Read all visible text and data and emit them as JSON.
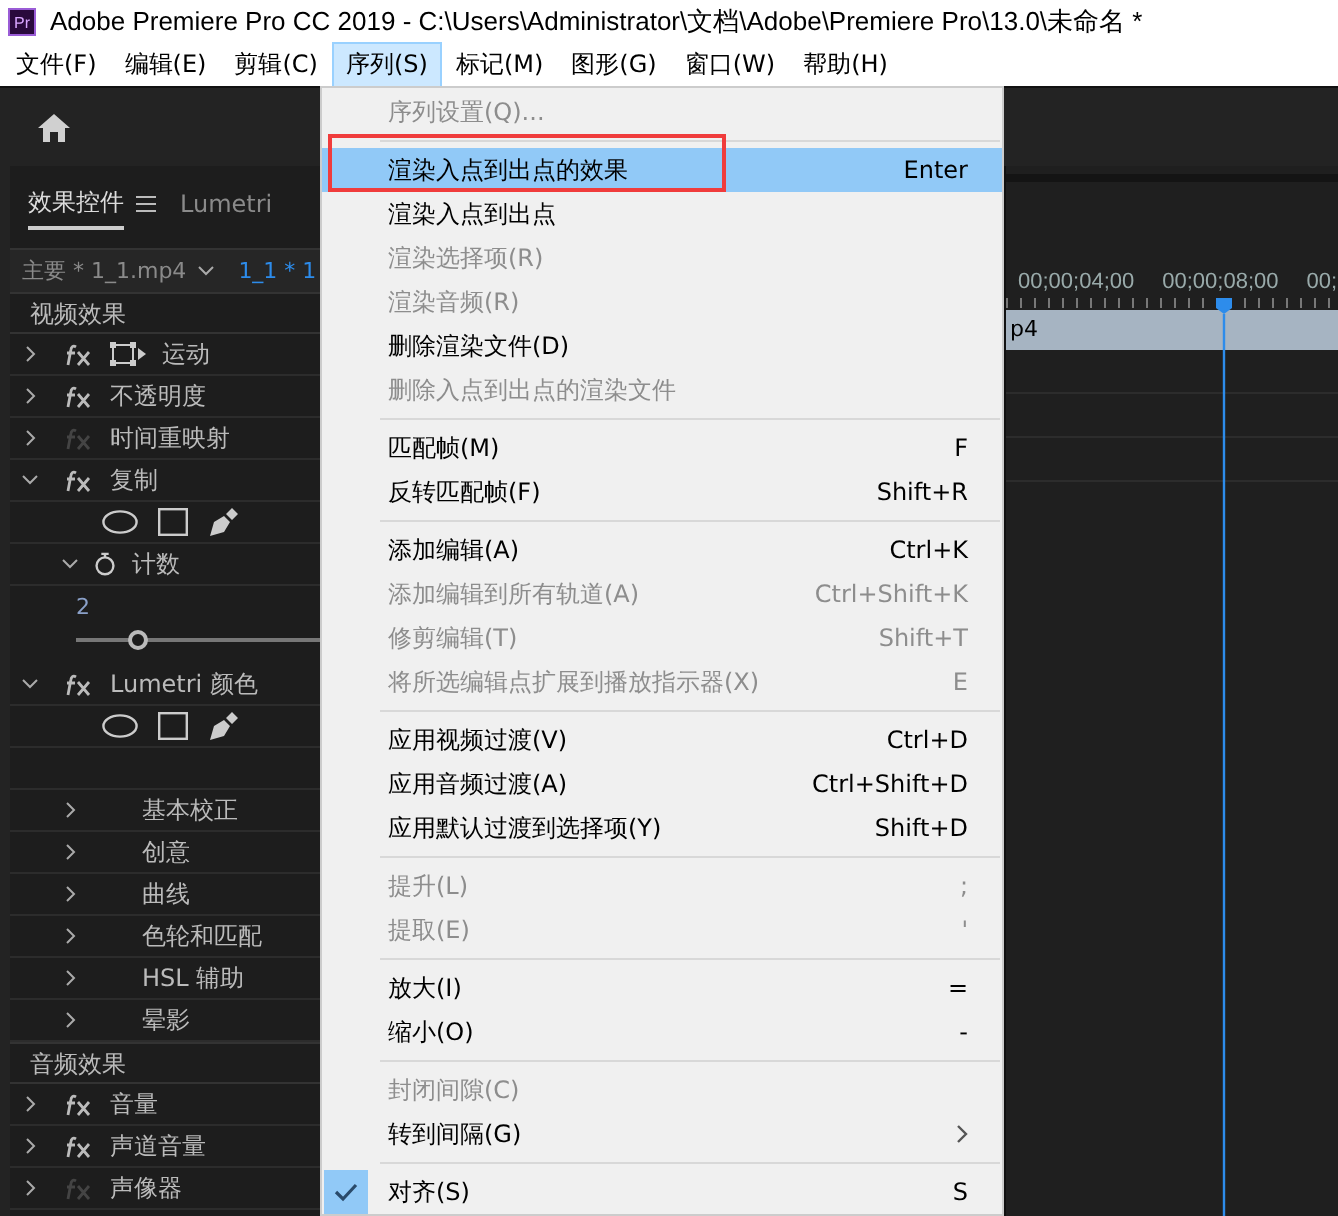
{
  "window": {
    "app_icon_text": "Pr",
    "title": "Adobe Premiere Pro CC 2019 - C:\\Users\\Administrator\\文档\\Adobe\\Premiere Pro\\13.0\\未命名 *"
  },
  "menubar": [
    {
      "label": "文件(F)",
      "selected": false
    },
    {
      "label": "编辑(E)",
      "selected": false
    },
    {
      "label": "剪辑(C)",
      "selected": false
    },
    {
      "label": "序列(S)",
      "selected": true
    },
    {
      "label": "标记(M)",
      "selected": false
    },
    {
      "label": "图形(G)",
      "selected": false
    },
    {
      "label": "窗口(W)",
      "selected": false
    },
    {
      "label": "帮助(H)",
      "selected": false
    }
  ],
  "effect_controls": {
    "tabs": [
      {
        "label": "效果控件",
        "selected": true
      },
      {
        "label": "Lumetri",
        "selected": false
      }
    ],
    "clip_source": "主要 * 1_1.mp4",
    "clip_sequence": "1_1 * 1",
    "sections": [
      {
        "title": "视频效果",
        "effects": [
          {
            "name": "运动",
            "expanded": false,
            "fx_enabled": true,
            "motion_icon": true
          },
          {
            "name": "不透明度",
            "expanded": false,
            "fx_enabled": true
          },
          {
            "name": "时间重映射",
            "expanded": false,
            "fx_enabled": false
          },
          {
            "name": "复制",
            "expanded": true,
            "fx_enabled": true,
            "mask_tools": true,
            "children": [
              {
                "kind": "param",
                "name": "计数",
                "expanded": true,
                "value": "2",
                "level": 0.24
              }
            ]
          },
          {
            "name": "Lumetri 颜色",
            "expanded": true,
            "fx_enabled": true,
            "mask_tools": true,
            "children": [
              {
                "kind": "group",
                "name": "基本校正",
                "expanded": false
              },
              {
                "kind": "group",
                "name": "创意",
                "expanded": false
              },
              {
                "kind": "group",
                "name": "曲线",
                "expanded": false
              },
              {
                "kind": "group",
                "name": "色轮和匹配",
                "expanded": false
              },
              {
                "kind": "group",
                "name": "HSL 辅助",
                "expanded": false
              },
              {
                "kind": "group",
                "name": "晕影",
                "expanded": false
              }
            ]
          }
        ]
      },
      {
        "title": "音频效果",
        "effects": [
          {
            "name": "音量",
            "expanded": false,
            "fx_enabled": true
          },
          {
            "name": "声道音量",
            "expanded": false,
            "fx_enabled": true
          },
          {
            "name": "声像器",
            "expanded": false,
            "fx_enabled": false
          }
        ]
      }
    ]
  },
  "timeline": {
    "ruler": [
      "00;00;04;00",
      "00;00;08;00",
      "00;"
    ],
    "clip_label": "p4"
  },
  "menu": {
    "items": [
      {
        "kind": "item",
        "label": "序列设置(Q)...",
        "disabled": true,
        "selected": false
      },
      {
        "kind": "separator"
      },
      {
        "kind": "item",
        "label": "渲染入点到出点的效果",
        "shortcut": "Enter",
        "disabled": false,
        "selected": true,
        "annotated": true
      },
      {
        "kind": "item",
        "label": "渲染入点到出点",
        "disabled": false,
        "selected": false
      },
      {
        "kind": "item",
        "label": "渲染选择项(R)",
        "disabled": true,
        "selected": false
      },
      {
        "kind": "item",
        "label": "渲染音频(R)",
        "disabled": true,
        "selected": false
      },
      {
        "kind": "item",
        "label": "删除渲染文件(D)",
        "disabled": false,
        "selected": false
      },
      {
        "kind": "item",
        "label": "删除入点到出点的渲染文件",
        "disabled": true,
        "selected": false
      },
      {
        "kind": "separator"
      },
      {
        "kind": "item",
        "label": "匹配帧(M)",
        "shortcut": "F",
        "disabled": false,
        "selected": false
      },
      {
        "kind": "item",
        "label": "反转匹配帧(F)",
        "shortcut": "Shift+R",
        "disabled": false,
        "selected": false
      },
      {
        "kind": "separator"
      },
      {
        "kind": "item",
        "label": "添加编辑(A)",
        "shortcut": "Ctrl+K",
        "disabled": false,
        "selected": false
      },
      {
        "kind": "item",
        "label": "添加编辑到所有轨道(A)",
        "shortcut": "Ctrl+Shift+K",
        "disabled": true,
        "selected": false
      },
      {
        "kind": "item",
        "label": "修剪编辑(T)",
        "shortcut": "Shift+T",
        "disabled": true,
        "selected": false
      },
      {
        "kind": "item",
        "label": "将所选编辑点扩展到播放指示器(X)",
        "shortcut": "E",
        "disabled": true,
        "selected": false
      },
      {
        "kind": "separator"
      },
      {
        "kind": "item",
        "label": "应用视频过渡(V)",
        "shortcut": "Ctrl+D",
        "disabled": false,
        "selected": false
      },
      {
        "kind": "item",
        "label": "应用音频过渡(A)",
        "shortcut": "Ctrl+Shift+D",
        "disabled": false,
        "selected": false
      },
      {
        "kind": "item",
        "label": "应用默认过渡到选择项(Y)",
        "shortcut": "Shift+D",
        "disabled": false,
        "selected": false
      },
      {
        "kind": "separator"
      },
      {
        "kind": "item",
        "label": "提升(L)",
        "shortcut": ";",
        "disabled": true,
        "selected": false
      },
      {
        "kind": "item",
        "label": "提取(E)",
        "shortcut": "'",
        "disabled": true,
        "selected": false
      },
      {
        "kind": "separator"
      },
      {
        "kind": "item",
        "label": "放大(I)",
        "shortcut": "=",
        "disabled": false,
        "selected": false
      },
      {
        "kind": "item",
        "label": "缩小(O)",
        "shortcut": "-",
        "disabled": false,
        "selected": false
      },
      {
        "kind": "separator"
      },
      {
        "kind": "item",
        "label": "封闭间隙(C)",
        "disabled": true,
        "selected": false
      },
      {
        "kind": "item",
        "label": "转到间隔(G)",
        "submenu": true,
        "disabled": false,
        "selected": false
      },
      {
        "kind": "separator"
      },
      {
        "kind": "item",
        "label": "对齐(S)",
        "shortcut": "S",
        "checked": true,
        "disabled": false,
        "selected": false
      }
    ]
  }
}
